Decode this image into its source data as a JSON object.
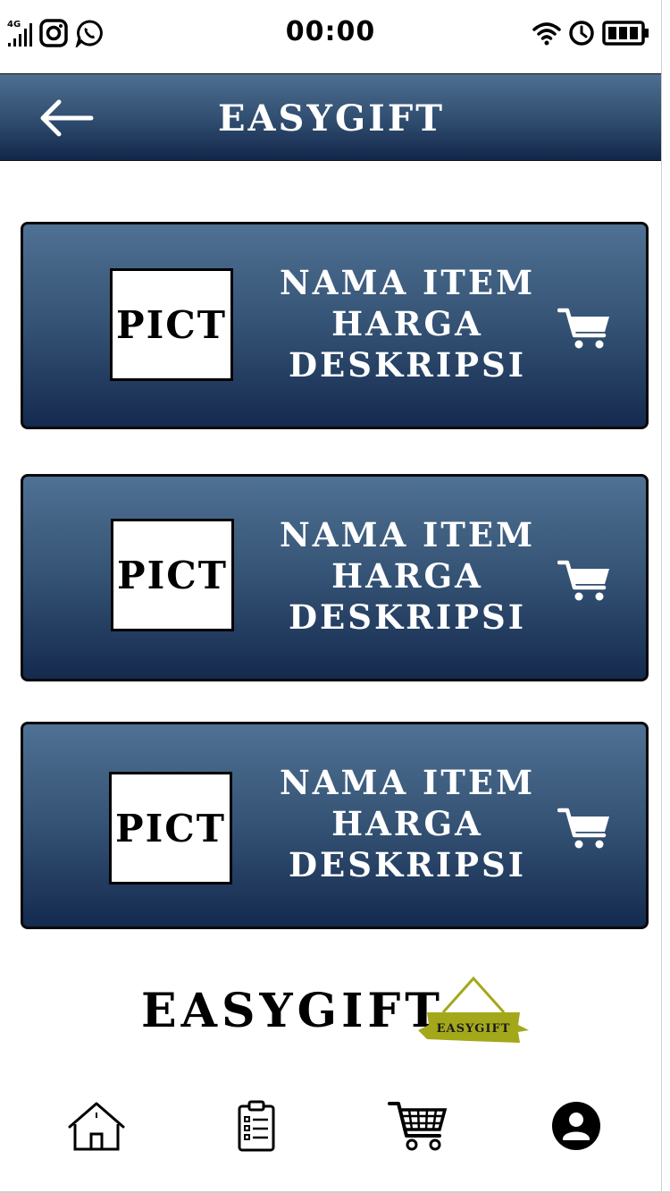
{
  "status_bar": {
    "time": "00:00",
    "network": "4G",
    "left_icons": [
      "signal-icon",
      "instagram-icon",
      "whatsapp-icon"
    ],
    "right_icons": [
      "wifi-icon",
      "alarm-clock-icon",
      "battery-icon"
    ]
  },
  "header": {
    "title": "EASYGIFT",
    "back_icon": "arrow-left-icon",
    "gradient_top": "#4d6f92",
    "gradient_bottom": "#12264a"
  },
  "products": [
    {
      "picture_label": "PICT",
      "name": "NAMA ITEM",
      "price": "HARGA",
      "description": "DESKRIPSI",
      "action_icon": "cart-icon"
    },
    {
      "picture_label": "PICT",
      "name": "NAMA ITEM",
      "price": "HARGA",
      "description": "DESKRIPSI",
      "action_icon": "cart-icon"
    },
    {
      "picture_label": "PICT",
      "name": "NAMA ITEM",
      "price": "HARGA",
      "description": "DESKRIPSI",
      "action_icon": "cart-icon"
    }
  ],
  "footer": {
    "brand": "EASYGIFT",
    "logo_text": "EASYGIFT",
    "logo_color": "#a3a81a"
  },
  "bottom_nav": {
    "items": [
      {
        "name": "home",
        "icon": "home-icon"
      },
      {
        "name": "orders",
        "icon": "clipboard-list-icon"
      },
      {
        "name": "cart",
        "icon": "shopping-cart-icon"
      },
      {
        "name": "profile",
        "icon": "user-circle-icon"
      }
    ]
  }
}
